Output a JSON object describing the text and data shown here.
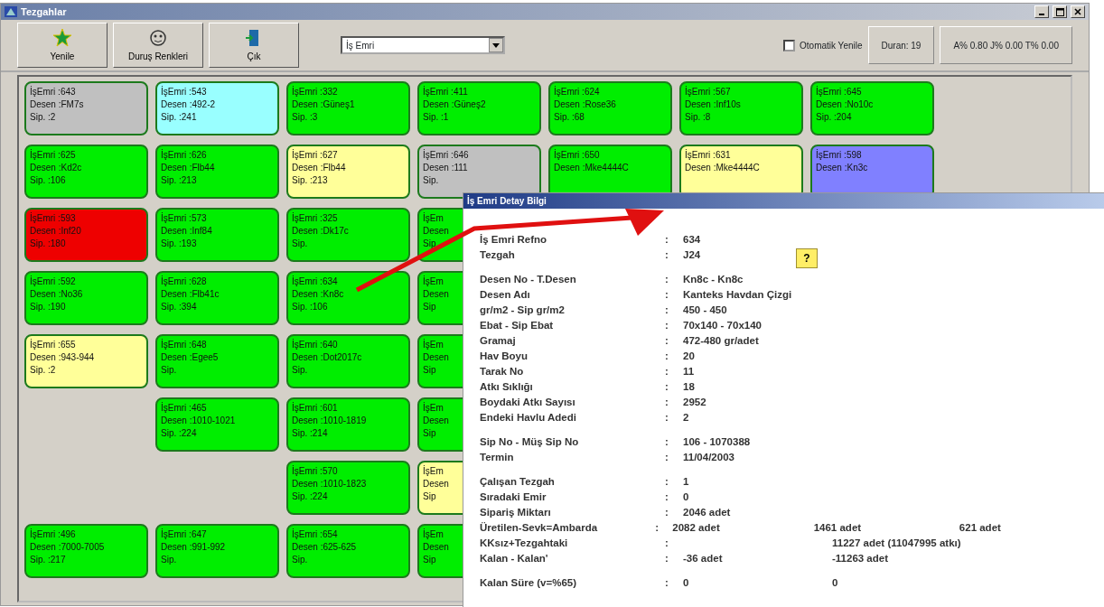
{
  "window": {
    "title": "Tezgahlar"
  },
  "toolbar": {
    "buttons": [
      {
        "label": "Yenile",
        "kind": "refresh"
      },
      {
        "label": "Duruş Renkleri",
        "kind": "colors"
      },
      {
        "label": "Çık",
        "kind": "exit"
      }
    ],
    "combo": {
      "value": "İş Emri"
    },
    "auto_refresh": {
      "label": "Otomatik Yenile",
      "checked": false
    },
    "panels": [
      "Duran: 19",
      "A% 0.80 J% 0.00 T% 0.00"
    ]
  },
  "grid": [
    [
      {
        "kind": "card",
        "color": "#c0c0c0",
        "lines": [
          "İşEmri :643",
          "Desen :FM7s",
          "Sip. :2"
        ]
      },
      {
        "kind": "card",
        "color": "#99ffff",
        "lines": [
          "İşEmri :543",
          "Desen :492-2",
          "Sip. :241"
        ]
      },
      {
        "kind": "card",
        "color": "#00ee00",
        "lines": [
          "İşEmri :332",
          "Desen :Güneş1",
          "Sip. :3"
        ]
      },
      {
        "kind": "card",
        "color": "#00ee00",
        "lines": [
          "İşEmri :411",
          "Desen :Güneş2",
          "Sip. :1"
        ]
      },
      {
        "kind": "card",
        "color": "#00ee00",
        "lines": [
          "İşEmri :624",
          "Desen :Rose36",
          "Sip. :68"
        ]
      },
      {
        "kind": "card",
        "color": "#00ee00",
        "lines": [
          "İşEmri :567",
          "Desen :Inf10s",
          "Sip. :8"
        ]
      },
      {
        "kind": "card",
        "color": "#00ee00",
        "lines": [
          "İşEmri :645",
          "Desen :No10c",
          "Sip. :204"
        ]
      }
    ],
    [
      {
        "kind": "card",
        "color": "#00ee00",
        "lines": [
          "İşEmri :625",
          "Desen :Kd2c",
          "Sip. :106"
        ]
      },
      {
        "kind": "card",
        "color": "#00ee00",
        "lines": [
          "İşEmri :626",
          "Desen :Flb44",
          "Sip. :213"
        ]
      },
      {
        "kind": "card",
        "color": "#ffff99",
        "lines": [
          "İşEmri :627",
          "Desen :Flb44",
          "Sip. :213"
        ]
      },
      {
        "kind": "card",
        "color": "#c0c0c0",
        "lines": [
          "İşEmri :646",
          "Desen :111",
          "Sip."
        ]
      },
      {
        "kind": "card",
        "color": "#00ee00",
        "lines": [
          "İşEmri :650",
          "Desen :Mke4444C"
        ]
      },
      {
        "kind": "card",
        "color": "#ffff99",
        "lines": [
          "İşEmri :631",
          "Desen :Mke4444C"
        ]
      },
      {
        "kind": "card",
        "color": "#8080ff",
        "lines": [
          "İşEmri :598",
          "Desen :Kn3c"
        ]
      }
    ],
    [
      {
        "kind": "card",
        "color": "#ee0000",
        "lines": [
          "İşEmri :593",
          "Desen :Inf20",
          "Sip. :180"
        ]
      },
      {
        "kind": "card",
        "color": "#00ee00",
        "lines": [
          "İşEmri :573",
          "Desen :Inf84",
          "Sip. :193"
        ]
      },
      {
        "kind": "card",
        "color": "#00ee00",
        "lines": [
          "İşEmri :325",
          "Desen :Dk17c",
          "Sip."
        ]
      },
      {
        "kind": "card",
        "color": "#00ee00",
        "lines": [
          "İşEm",
          "Desen",
          "Sip"
        ]
      }
    ],
    [
      {
        "kind": "card",
        "color": "#00ee00",
        "lines": [
          "İşEmri :592",
          "Desen :No36",
          "Sip. :190"
        ]
      },
      {
        "kind": "card",
        "color": "#00ee00",
        "lines": [
          "İşEmri :628",
          "Desen :Flb41c",
          "Sip. :394"
        ]
      },
      {
        "kind": "card",
        "color": "#00ee00",
        "lines": [
          "İşEmri :634",
          "Desen :Kn8c",
          "Sip. :106"
        ]
      },
      {
        "kind": "card",
        "color": "#00ee00",
        "lines": [
          "İşEm",
          "Desen",
          "Sip"
        ]
      }
    ],
    [
      {
        "kind": "card",
        "color": "#ffff99",
        "lines": [
          "İşEmri :655",
          "Desen :943-944",
          "Sip. :2"
        ]
      },
      {
        "kind": "card",
        "color": "#00ee00",
        "lines": [
          "İşEmri :648",
          "Desen :Egee5",
          "Sip."
        ]
      },
      {
        "kind": "card",
        "color": "#00ee00",
        "lines": [
          "İşEmri :640",
          "Desen :Dot2017c",
          "Sip."
        ]
      },
      {
        "kind": "card",
        "color": "#00ee00",
        "lines": [
          "İşEm",
          "Desen",
          "Sip"
        ]
      }
    ],
    [
      {
        "kind": "empty"
      },
      {
        "kind": "card",
        "color": "#00ee00",
        "lines": [
          "İşEmri :465",
          "Desen :1010-1021",
          "Sip. :224"
        ]
      },
      {
        "kind": "card",
        "color": "#00ee00",
        "lines": [
          "İşEmri :601",
          "Desen :1010-1819",
          "Sip. :214"
        ]
      },
      {
        "kind": "card",
        "color": "#00ee00",
        "lines": [
          "İşEm",
          "Desen",
          "Sip"
        ]
      }
    ],
    [
      {
        "kind": "empty"
      },
      {
        "kind": "empty"
      },
      {
        "kind": "card",
        "color": "#00ee00",
        "lines": [
          "İşEmri :570",
          "Desen :1010-1823",
          "Sip. :224"
        ]
      },
      {
        "kind": "card",
        "color": "#ffff99",
        "lines": [
          "İşEm",
          "Desen",
          "Sip"
        ]
      }
    ],
    [
      {
        "kind": "card",
        "color": "#00ee00",
        "lines": [
          "İşEmri :496",
          "Desen :7000-7005",
          "Sip. :217"
        ]
      },
      {
        "kind": "card",
        "color": "#00ee00",
        "lines": [
          "İşEmri :647",
          "Desen :991-992",
          "Sip."
        ]
      },
      {
        "kind": "card",
        "color": "#00ee00",
        "lines": [
          "İşEmri :654",
          "Desen :625-625",
          "Sip."
        ]
      },
      {
        "kind": "card",
        "color": "#00ee00",
        "lines": [
          "İşEm",
          "Desen",
          "Sip"
        ]
      }
    ]
  ],
  "detail_popup": {
    "title": "İş Emri Detay Bilgi",
    "help_button": "?",
    "groups": [
      [
        {
          "label": "İş Emri Refno",
          "sep": ":",
          "value": "634"
        },
        {
          "label": "Tezgah",
          "sep": ":",
          "value": "J24"
        }
      ],
      [
        {
          "label": "Desen No  -  T.Desen",
          "sep": ":",
          "value": "Kn8c  -  Kn8c"
        },
        {
          "label": "Desen Adı",
          "sep": ":",
          "value": "Kanteks Havdan Çizgi"
        },
        {
          "label": "gr/m2  -  Sip gr/m2",
          "sep": ":",
          "value": "450  -  450"
        },
        {
          "label": "Ebat  -  Sip Ebat",
          "sep": ":",
          "value": "70x140  -  70x140"
        },
        {
          "label": "Gramaj",
          "sep": ":",
          "value": "472-480 gr/adet"
        },
        {
          "label": "Hav Boyu",
          "sep": ":",
          "value": "20"
        },
        {
          "label": "Tarak No",
          "sep": ":",
          "value": "11"
        },
        {
          "label": "Atkı Sıklığı",
          "sep": ":",
          "value": "18"
        },
        {
          "label": "Boydaki Atkı Sayısı",
          "sep": ":",
          "value": "2952"
        },
        {
          "label": "Endeki Havlu Adedi",
          "sep": ":",
          "value": "2"
        }
      ],
      [
        {
          "label": "Sip No  -  Müş Sip No",
          "sep": ":",
          "value": "106  -  1070388"
        },
        {
          "label": "Termin",
          "sep": ":",
          "value": "11/04/2003"
        }
      ],
      [
        {
          "label": "Çalışan Tezgah",
          "sep": ":",
          "value": "1"
        },
        {
          "label": "Sıradaki Emir",
          "sep": ":",
          "value": "0"
        },
        {
          "label": "Sipariş Miktarı",
          "sep": ":",
          "value": "2046 adet"
        },
        {
          "label": "Üretilen-Sevk=Ambarda",
          "sep": ":",
          "value": "2082 adet",
          "extra": [
            "1461 adet",
            "621 adet"
          ]
        },
        {
          "label": "KKsız+Tezgahtaki",
          "sep": ":",
          "extra": [
            "11227 adet  (11047995 atkı)"
          ]
        },
        {
          "label": "Kalan  -  Kalan'",
          "sep": ":",
          "value": "-36 adet",
          "extra": [
            "-11263 adet"
          ]
        }
      ],
      [
        {
          "label": "Kalan Süre (v=%65)",
          "sep": ":",
          "value": "0",
          "extra": [
            "0"
          ]
        }
      ]
    ]
  }
}
